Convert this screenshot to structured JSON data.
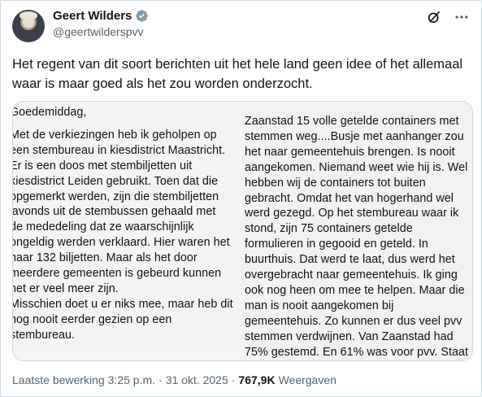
{
  "author": {
    "display_name": "Geert Wilders",
    "handle": "@geertwilderspvv",
    "verified_color": "#829aab"
  },
  "header_icons": [
    "grok-icon",
    "more-icon"
  ],
  "tweet": {
    "text": "Het regent van dit soort berichten uit het hele land geen idee of het allemaal waar is maar goed als het zou worden onderzocht."
  },
  "media": {
    "left_lines": [
      "Goedemiddag,",
      "",
      "Met de verkiezingen heb ik geholpen op",
      "een stembureau in kiesdistrict Maastricht.",
      "Er is een doos met stembiljetten uit",
      "kiesdistrict Leiden gebruikt. Toen dat die",
      "opgemerkt werden, zijn die stembiljetten",
      "'avonds uit de stembussen gehaald met",
      "de mededeling dat ze waarschijnlijk",
      "ongeldig werden verklaard. Hier waren het",
      "naar 132 biljetten. Maar als het door",
      "meerdere gemeenten is gebeurd kunnen",
      "het er veel meer zijn.",
      "Misschien doet u er niks mee, maar heb dit",
      "nog nooit eerder gezien op een",
      "stembureau."
    ],
    "right_lines": [
      "Zaanstad 15 volle getelde containers met",
      "stemmen weg....Busje met aanhanger zou",
      "het naar gemeentehuis brengen. Is nooit",
      "aangekomen. Niemand weet wie hij is. Wel",
      "hebben wij de containers tot buiten",
      "gebracht. Omdat het van hogerhand wel",
      "werd gezegd.  Op het stembureau waar ik",
      "stond, zijn 75 containers getelde",
      "formulieren in gegooid en geteld. In",
      "buurthuis. Dat werd te laat, dus werd het",
      "overgebracht naar gemeentehuis. Ik ging",
      "ook nog heen om mee te helpen. Maar die",
      "man is nooit aangekomen bij",
      "gemeentehuis. Zo kunnen er dus veel pvv",
      "stemmen verdwijnen. Van Zaanstad had",
      "75% gestemd. En 61% was voor pvv. Staat"
    ]
  },
  "footer": {
    "edited_label": "Laatste bewerking",
    "time": "3:25 p.m.",
    "sep": "·",
    "date": "31 okt. 2025",
    "sep2": "·",
    "views_count": "767,9K",
    "views_label": "Weergaven"
  }
}
